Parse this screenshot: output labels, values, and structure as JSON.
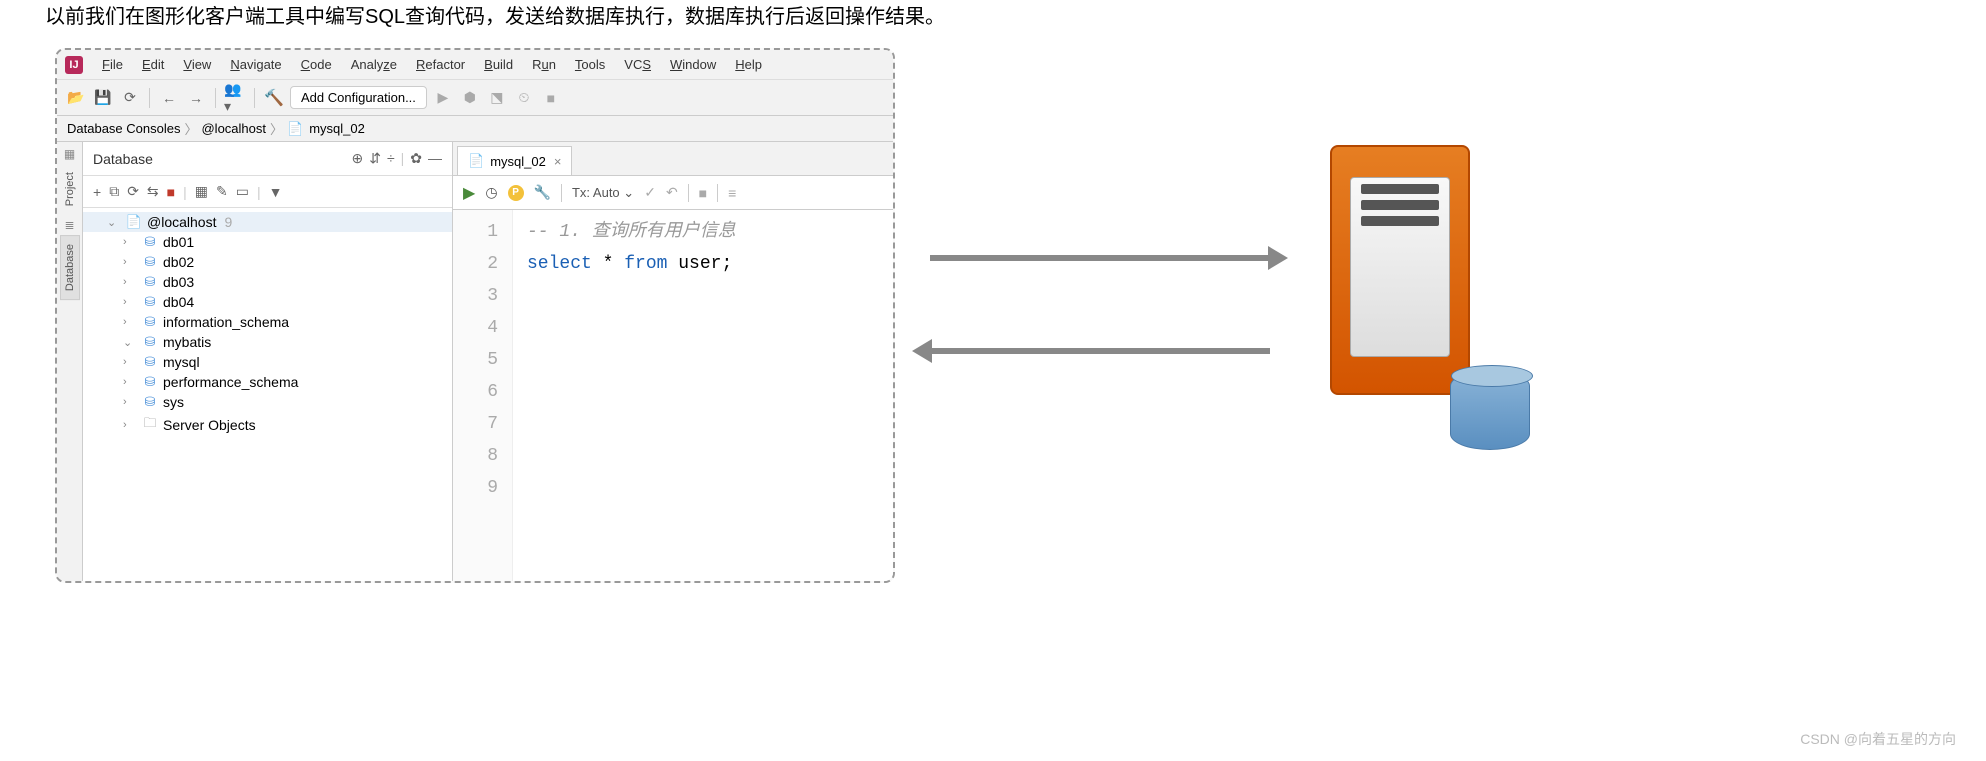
{
  "page_caption_visible": "以前我们在图形化客户端工具中编写SQL查询代码，发送给数据库执行，数据库执行后返回操作结果。",
  "app_icon_letter": "IJ",
  "menus": [
    "File",
    "Edit",
    "View",
    "Navigate",
    "Code",
    "Analyze",
    "Refactor",
    "Build",
    "Run",
    "Tools",
    "VCS",
    "Window",
    "Help"
  ],
  "config_label": "Add Configuration...",
  "breadcrumb": {
    "seg0": "Database Consoles",
    "seg1": "@localhost",
    "seg2": "mysql_02"
  },
  "side_tabs": {
    "project": "Project",
    "database": "Database"
  },
  "db_panel": {
    "title": "Database",
    "host": "@localhost",
    "host_count": "9",
    "items": [
      {
        "label": "db01",
        "icon": "schema",
        "expanded": false
      },
      {
        "label": "db02",
        "icon": "schema",
        "expanded": false
      },
      {
        "label": "db03",
        "icon": "schema",
        "expanded": false
      },
      {
        "label": "db04",
        "icon": "schema",
        "expanded": false
      },
      {
        "label": "information_schema",
        "icon": "schema",
        "expanded": false
      },
      {
        "label": "mybatis",
        "icon": "schema",
        "expanded": true
      },
      {
        "label": "mysql",
        "icon": "schema",
        "expanded": false
      },
      {
        "label": "performance_schema",
        "icon": "schema",
        "expanded": false
      },
      {
        "label": "sys",
        "icon": "schema",
        "expanded": false
      },
      {
        "label": "Server Objects",
        "icon": "folder",
        "expanded": false
      }
    ]
  },
  "tab_name": "mysql_02",
  "editor_toolbar": {
    "tx_label": "Tx: Auto",
    "tx_caret": "⌄"
  },
  "gutter_lines": [
    "1",
    "2",
    "3",
    "4",
    "5",
    "6",
    "7",
    "8",
    "9"
  ],
  "code": {
    "comment": "-- 1. 查询所有用户信息",
    "kw1": "select",
    "star": " * ",
    "kw2": "from",
    "tbl": " user;"
  },
  "watermark": "CSDN @向着五星的方向"
}
